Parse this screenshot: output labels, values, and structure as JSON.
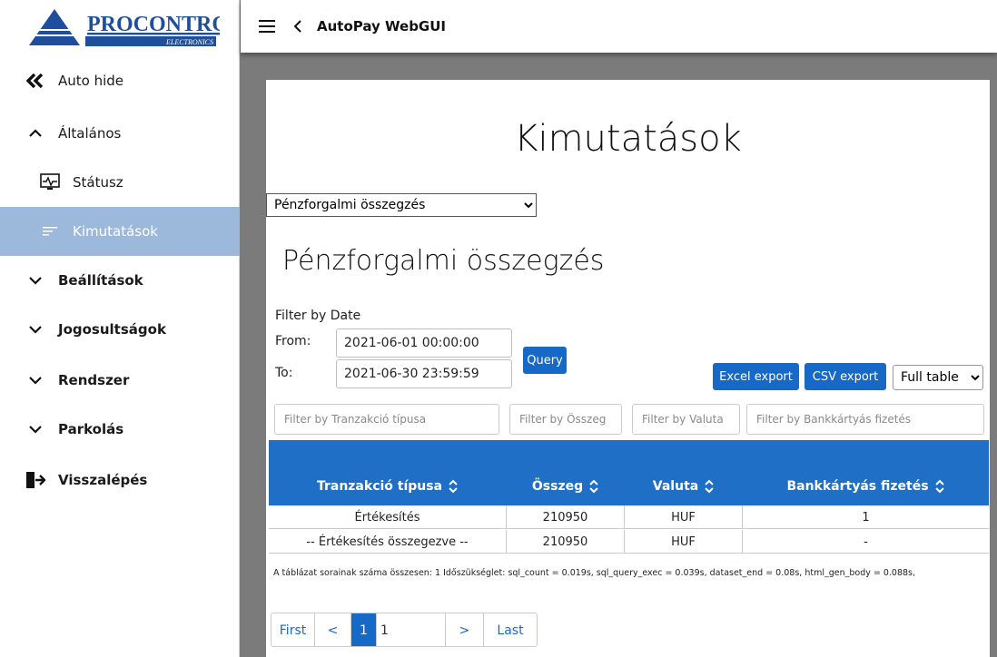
{
  "brand": {
    "name": "PROCONTROL",
    "tagline": "ELECTRONICS",
    "color": "#1f4e9c"
  },
  "app": {
    "title": "AutoPay WebGUI"
  },
  "sidebar": {
    "items": [
      {
        "label": "Auto hide",
        "icon": "double-chevron-left-icon"
      },
      {
        "label": "Általános",
        "icon": "chevron-up-icon"
      },
      {
        "label": "Státusz",
        "icon": "monitor-pulse-icon"
      },
      {
        "label": "Kimutatások",
        "icon": "list-lines-icon",
        "active": true
      },
      {
        "label": "Beállítások",
        "icon": "chevron-down-icon"
      },
      {
        "label": "Jogosultságok",
        "icon": "chevron-down-icon"
      },
      {
        "label": "Rendszer",
        "icon": "chevron-down-icon"
      },
      {
        "label": "Parkolás",
        "icon": "chevron-down-icon"
      },
      {
        "label": "Visszalépés",
        "icon": "logout-door-icon"
      }
    ],
    "active_color": "#9cb9db"
  },
  "main": {
    "title": "Kimutatások",
    "report_select": {
      "selected": "Pénzforgalmi összegzés"
    },
    "section_title": "Pénzforgalmi összegzés",
    "filter": {
      "label": "Filter by Date",
      "from_label": "From:",
      "from_value": "2021-06-01 00:00:00",
      "to_label": "To:",
      "to_value": "2021-06-30 23:59:59",
      "query_label": "Query"
    },
    "export": {
      "excel_label": "Excel export",
      "csv_label": "CSV export",
      "view_selected": "Full table"
    },
    "column_filters": [
      "Filter by Tranzakció típusa",
      "Filter by Összeg",
      "Filter by Valuta",
      "Filter by Bankkártyás fizetés"
    ],
    "table": {
      "header_color": "#1e6fc5",
      "columns": [
        "Tranzakció típusa",
        "Összeg",
        "Valuta",
        "Bankkártyás fizetés"
      ],
      "rows": [
        [
          "Értékesítés",
          "210950",
          "HUF",
          "1"
        ],
        [
          "-- Értékesítés összegezve --",
          "210950",
          "HUF",
          "-"
        ]
      ]
    },
    "footnote": "A táblázat sorainak száma összesen: 1   Időszükséglet: sql_count = 0.019s, sql_query_exec = 0.039s, dataset_end = 0.08s, html_gen_body = 0.088s,",
    "pagination": {
      "first": "First",
      "prev": "<",
      "current": "1",
      "page_input": "1",
      "next": ">",
      "last": "Last"
    }
  }
}
